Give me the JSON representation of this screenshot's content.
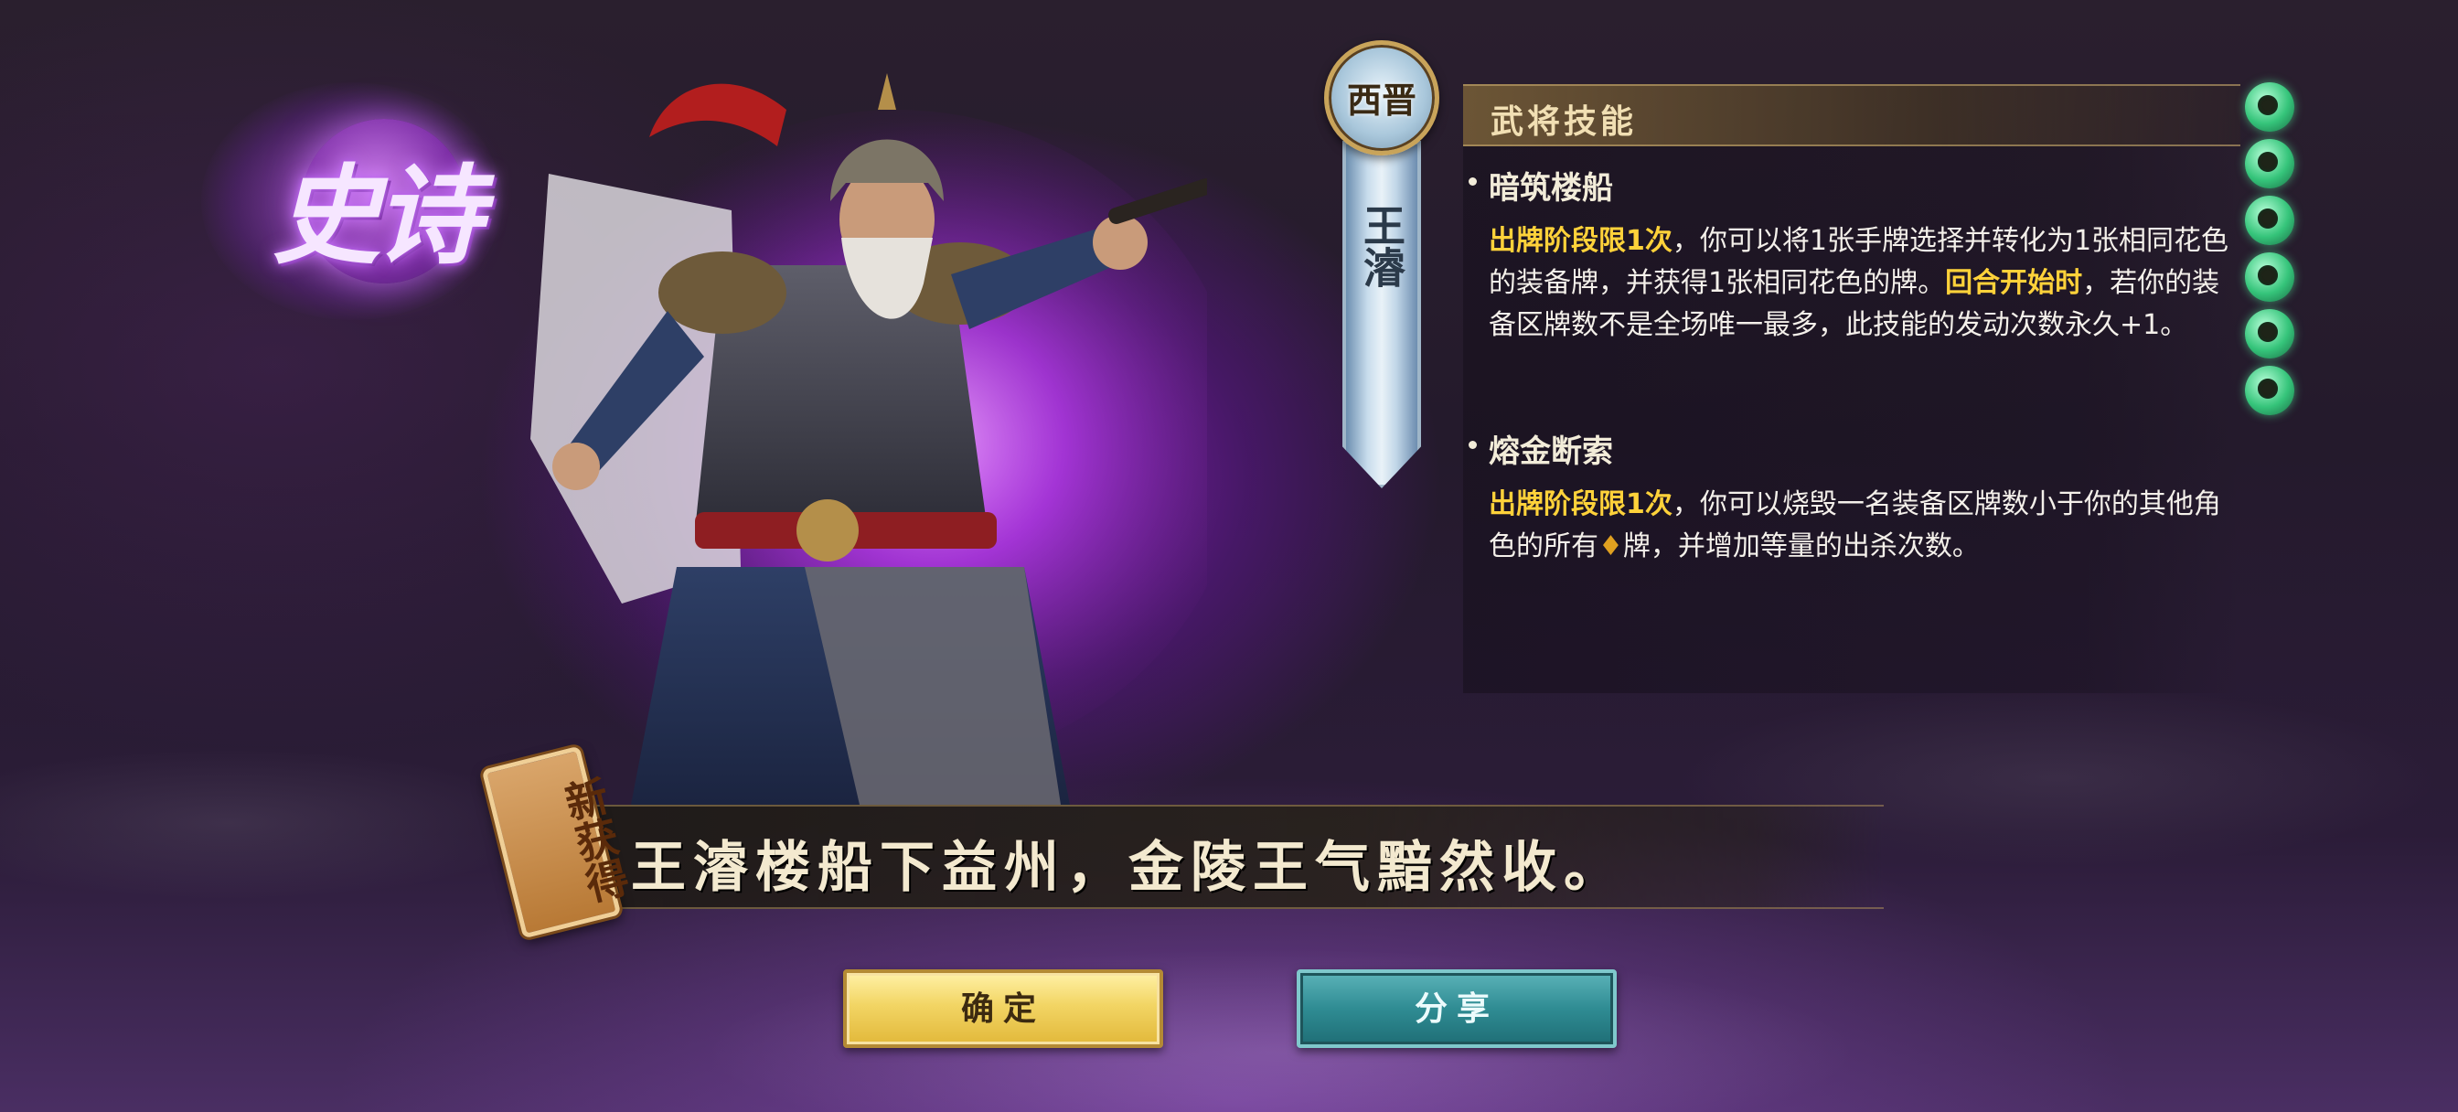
{
  "rarity": {
    "label": "史诗"
  },
  "hero": {
    "faction": "西晋",
    "name": "王濬"
  },
  "skills": {
    "header": "武将技能",
    "items": [
      {
        "name": "暗筑楼船",
        "parts": [
          {
            "text": "出牌阶段限1次",
            "highlight": true
          },
          {
            "text": "，你可以将1张手牌选择并转化为1张相同花色的装备牌，并获得1张相同花色的牌。",
            "highlight": false
          },
          {
            "text": "回合开始时",
            "highlight": true
          },
          {
            "text": "，若你的装备区牌数不是全场唯一最多，此技能的发动次数永久+1。",
            "highlight": false
          }
        ]
      },
      {
        "name": "熔金断索",
        "parts": [
          {
            "text": "出牌阶段限1次",
            "highlight": true
          },
          {
            "text": "，你可以烧毁一名装备区牌数小于你的其他角色的所有",
            "highlight": false
          },
          {
            "text": "♦",
            "highlight": false,
            "suit": true
          },
          {
            "text": "牌，并增加等量的出杀次数。",
            "highlight": false
          }
        ]
      }
    ]
  },
  "jade_count": 6,
  "new_tag": "新获得",
  "quote": "王濬楼船下益州，金陵王气黯然收。",
  "buttons": {
    "confirm": "确定",
    "share": "分享"
  },
  "colors": {
    "highlight": "#ffd23a",
    "confirm_bg": "#f2d564",
    "share_bg": "#2f8c93",
    "aura": "#aa28e6"
  }
}
